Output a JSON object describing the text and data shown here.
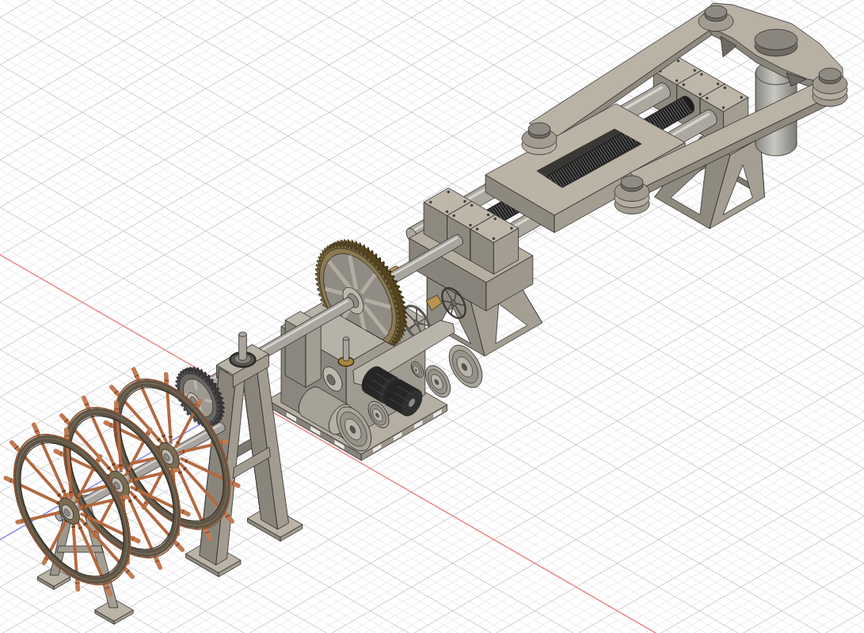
{
  "viewport": {
    "grid": true,
    "axes": true
  },
  "model": {
    "parts": [
      {
        "kind": "stand"
      },
      {
        "kind": "post"
      },
      {
        "kind": "bearings"
      },
      {
        "kind": "screws"
      },
      {
        "kind": "tiller"
      },
      {
        "kind": "stand"
      },
      {
        "kind": "bearings"
      },
      {
        "kind": "gearbox"
      },
      {
        "kind": "shaft"
      },
      {
        "kind": "gear"
      },
      {
        "kind": "shaft"
      },
      {
        "kind": "pedestal"
      },
      {
        "kind": "gear"
      },
      {
        "kind": "stand"
      },
      {
        "kind": "shaft"
      },
      {
        "kind": "wheel"
      },
      {
        "kind": "wheel"
      },
      {
        "kind": "wheel"
      }
    ]
  }
}
